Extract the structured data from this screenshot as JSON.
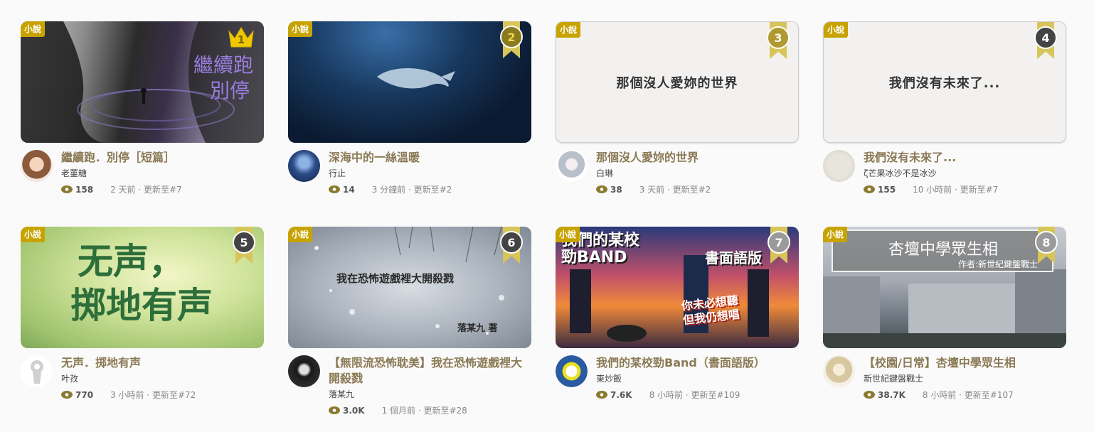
{
  "tag_label": "小說",
  "colors": {
    "accent": "#c7a300",
    "title": "#8a7a55"
  },
  "cards": [
    {
      "rank": "1",
      "title": "繼續跑．別停［短篇］",
      "author": "老菫糖",
      "views": "158",
      "updated": "2 天前 · 更新至#7",
      "cover_text": [
        "繼續跑",
        "別停"
      ],
      "icon": "crown-icon"
    },
    {
      "rank": "2",
      "title": "深海中的一絲溫暖",
      "author": "行止",
      "views": "14",
      "updated": "3 分鐘前 · 更新至#2"
    },
    {
      "rank": "3",
      "title": "那個沒人愛妳的世界",
      "author": "白琳",
      "views": "38",
      "updated": "3 天前 · 更新至#2",
      "cover_text": "那個沒人愛妳的世界"
    },
    {
      "rank": "4",
      "title": "我們沒有未來了...",
      "author": "ζ芒果冰沙不是冰沙",
      "views": "155",
      "updated": "10 小時前 · 更新至#7",
      "cover_text": "我們沒有未來了..."
    },
    {
      "rank": "5",
      "title": "无声．掷地有声",
      "author": "叶孜",
      "views": "770",
      "updated": "3 小時前 · 更新至#72",
      "cover_text": [
        "无声，",
        "掷地有声"
      ]
    },
    {
      "rank": "6",
      "title": "【無限流恐怖耽美】我在恐怖遊戲裡大開殺戮",
      "author": "落某九",
      "views": "3.0K",
      "updated": "1 個月前 · 更新至#28",
      "cover_text": [
        "我在恐怖遊戲裡大開殺戮",
        "落某九 著"
      ]
    },
    {
      "rank": "7",
      "title": "我們的某校勁Band（書面語版）",
      "author": "東炒飯",
      "views": "7.6K",
      "updated": "8 小時前 · 更新至#109",
      "cover_text": [
        "我們的某校",
        "勁BAND",
        "書面語版",
        "你未必想聽",
        "但我仍想唱"
      ]
    },
    {
      "rank": "8",
      "title": "【校園/日常】杏壇中學眾生相",
      "author": "新世紀鍵盤戰士",
      "views": "38.7K",
      "updated": "8 小時前 · 更新至#107",
      "cover_text": [
        "杏壇中學眾生相",
        "作者:新世紀鍵盤戰士"
      ]
    }
  ]
}
